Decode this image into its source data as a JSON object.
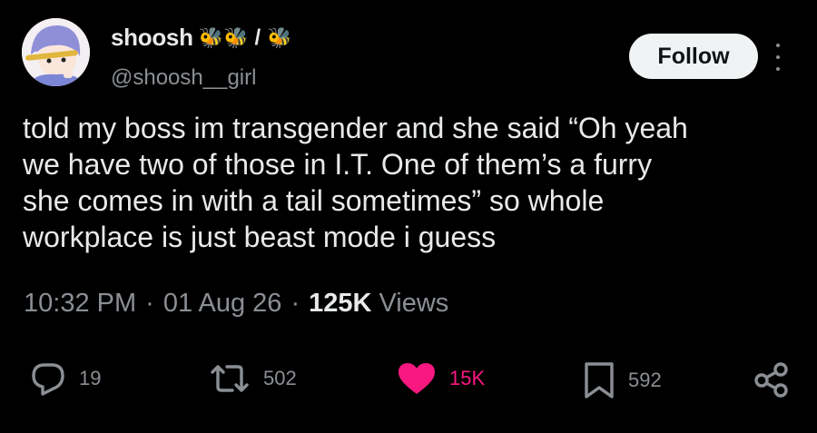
{
  "author": {
    "display_name": "shoosh",
    "emoji_a": "🐝🐝",
    "separator": "/",
    "emoji_b": "🐝",
    "handle": "@shoosh__girl"
  },
  "follow_label": "Follow",
  "tweet": {
    "text": "told my boss im transgender and she said “Oh yeah\nwe have two of those in I.T. One of them’s a furry\nshe comes in with a tail sometimes” so whole\nworkplace is just beast mode i guess"
  },
  "meta": {
    "time": "10:32 PM",
    "dot1": "·",
    "date": "01 Aug 26",
    "dot2": "·",
    "views_count": "125K",
    "views_label": "Views"
  },
  "actions": {
    "replies": "19",
    "retweets": "502",
    "likes": "15K",
    "bookmarks": "592"
  },
  "colors": {
    "background": "#000000",
    "text": "#e7e9ea",
    "muted": "#8b8f94",
    "like": "#f91880",
    "follow_bg": "#eff3f4"
  },
  "icons": [
    "reply-icon",
    "retweet-icon",
    "heart-icon",
    "bookmark-icon",
    "share-icon",
    "more-icon"
  ]
}
